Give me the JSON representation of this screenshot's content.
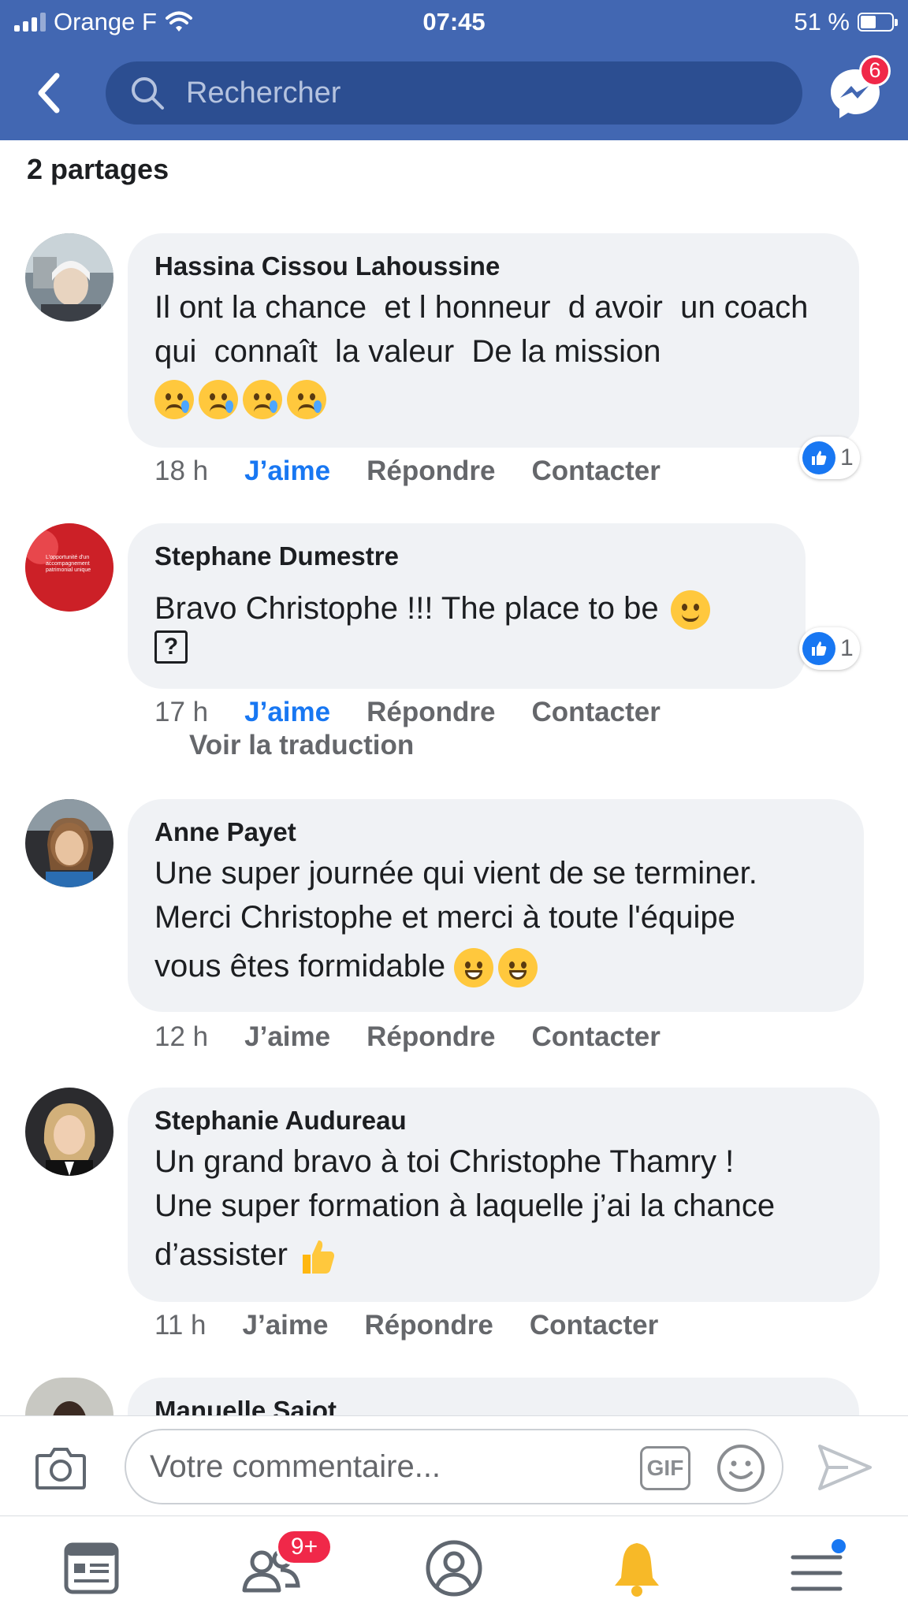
{
  "status_bar": {
    "carrier": "Orange F",
    "time": "07:45",
    "battery": "51 %",
    "battery_level": 0.51
  },
  "header": {
    "search_placeholder": "Rechercher",
    "messenger_badge": "6"
  },
  "shares_label": "2 partages",
  "comments": [
    {
      "author": "Hassina Cissou Lahoussine",
      "text": "Il ont la chance  et l honneur  d avoir  un coach  qui  connaît  la valeur  De la mission",
      "time": "18 h",
      "like": "J’aime",
      "reply": "Répondre",
      "contact": "Contacter",
      "reaction_count": "1"
    },
    {
      "author": "Stephane Dumestre",
      "text": "Bravo Christophe !!! The place to be",
      "unknown_glyph": "?",
      "time": "17 h",
      "like": "J’aime",
      "reply": "Répondre",
      "contact": "Contacter",
      "translate": "Voir la traduction",
      "reaction_count": "1",
      "avatar_text": "L'opportunité d'un accompagnement patrimonial unique"
    },
    {
      "author": "Anne Payet",
      "text_line1": "Une super journée qui vient de se terminer.",
      "text_line2": "Merci Christophe et merci à toute l'équipe",
      "text_line3": "vous êtes formidable",
      "time": "12 h",
      "like": "J’aime",
      "reply": "Répondre",
      "contact": "Contacter"
    },
    {
      "author": "Stephanie Audureau",
      "text_line1": "Un grand bravo à toi Christophe Thamry !",
      "text_line2": "Une super formation à laquelle j’ai la chance",
      "text_line3": "d’assister",
      "time": "11 h",
      "like": "J’aime",
      "reply": "Répondre",
      "contact": "Contacter"
    },
    {
      "author": "Manuelle Saiot"
    }
  ],
  "composer": {
    "placeholder": "Votre commentaire...",
    "gif_label": "GIF"
  },
  "bottom_nav": {
    "friends_badge": "9+"
  },
  "colors": {
    "header_blue": "#4267b2",
    "search_bg": "#2c4e91",
    "like_blue": "#1877f2",
    "bubble_grey": "#f0f2f5",
    "badge_red": "#f02849"
  }
}
